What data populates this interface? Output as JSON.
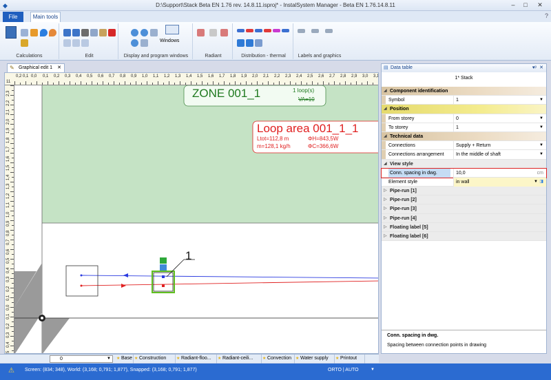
{
  "window": {
    "title": "D:\\Support\\Stack Beta EN 1.76 rev. 14.8.11.isproj* - InstalSystem Manager - Beta EN 1.76.14.8.11",
    "minimize": "–",
    "maximize": "□",
    "close": "✕"
  },
  "ribbon": {
    "file_tab": "File",
    "main_tab": "Main tools",
    "help_icon": "?",
    "groups": {
      "calculations": "Calculations",
      "edit": "Edit",
      "display": "Display and program windows",
      "windows_button": "Windows",
      "radiant": "Radiant",
      "distribution": "Distribution - thermal",
      "labels": "Labels and graphics"
    }
  },
  "document": {
    "tab_label": "Graphical edit 1",
    "tab_close": "✕"
  },
  "ruler": {
    "top": [
      "11",
      "0,2",
      "0,1",
      "0,0",
      "0,1",
      "0,2",
      "0,3",
      "0,4",
      "0,5",
      "0,6",
      "0,7",
      "0,8",
      "0,9",
      "1,0",
      "1,1",
      "1,2",
      "1,3",
      "1,4",
      "1,5",
      "1,6",
      "1,7",
      "1,8",
      "1,9",
      "2,0",
      "2,1",
      "2,2",
      "2,3",
      "2,4",
      "2,5",
      "2,6",
      "2,7",
      "2,8",
      "2,9",
      "3,0",
      "3,1",
      "3,2",
      "3,3"
    ],
    "left": [
      "2,3",
      "2,2",
      "2,1",
      "2,0",
      "1,9",
      "1,8",
      "1,7",
      "1,6",
      "1,5",
      "1,4",
      "1,3",
      "1,2",
      "1,1",
      "1,0",
      "0,9",
      "0,8",
      "0,7",
      "0,6",
      "0,5",
      "0,4",
      "0,3",
      "0,2",
      "0,1",
      "0,0",
      "0,1",
      "0,2",
      "0,3",
      "0,4",
      "0,5"
    ]
  },
  "drawing": {
    "zone": {
      "title": "ZONE 001_1",
      "loops": "1 loop(s)",
      "va": "VA=10"
    },
    "loop": {
      "title": "Loop area 001_1_1",
      "ltot": "Ltot=112,8 m",
      "phi_h": "ΦH=843,5W",
      "m": "m=128,1 kg/h",
      "phi_c": "ΦC=366,6W"
    },
    "stack_number": "1"
  },
  "data_table": {
    "header": "Data table",
    "pin": "▾ᵖ",
    "close": "✕",
    "subtitle": "1* Stack",
    "cat_component": "Component identification",
    "symbol_label": "Symbol",
    "symbol_value": "1",
    "cat_position": "Position",
    "from_label": "From storey",
    "from_value": "0",
    "to_label": "To storey",
    "to_value": "1",
    "cat_technical": "Technical data",
    "connections_label": "Connections",
    "connections_value": "Supply + Return",
    "arrangement_label": "Connections arrangement",
    "arrangement_value": "In the middle of shaft",
    "cat_view": "View style",
    "spacing_label": "Conn. spacing in dwg.",
    "spacing_value": "10,0",
    "spacing_unit": "cm",
    "element_label": "Element style",
    "element_value": "in wall",
    "collapsed": [
      "Pipe-run [1]",
      "Pipe-run [2]",
      "Pipe-run [3]",
      "Pipe-run [4]",
      "Floating label [5]",
      "Floating label [6]"
    ],
    "desc_title": "Conn. spacing in dwg.",
    "desc_text": "Spacing between connection points in drawing"
  },
  "sheets": {
    "storey": "0",
    "tabs": [
      "Base",
      "Construction",
      "Radiant-floo...",
      "Radiant-ceili...",
      "Convection",
      "Water supply",
      "Printout"
    ]
  },
  "status": {
    "coords": "Screen: (834; 348), World: (3,168; 0,791; 1,877), Snapped: (3,168; 0,791; 1,877)",
    "mode": "ORTO | AUTO",
    "warning_icon": "warning-icon"
  },
  "colors": {
    "zone_green": "#c5e3c5",
    "zone_text": "#1f7a1f",
    "loop_red": "#e02020",
    "supply_blue": "#2b3be0",
    "return_red": "#e02020",
    "status_blue": "#2b6bd1"
  }
}
